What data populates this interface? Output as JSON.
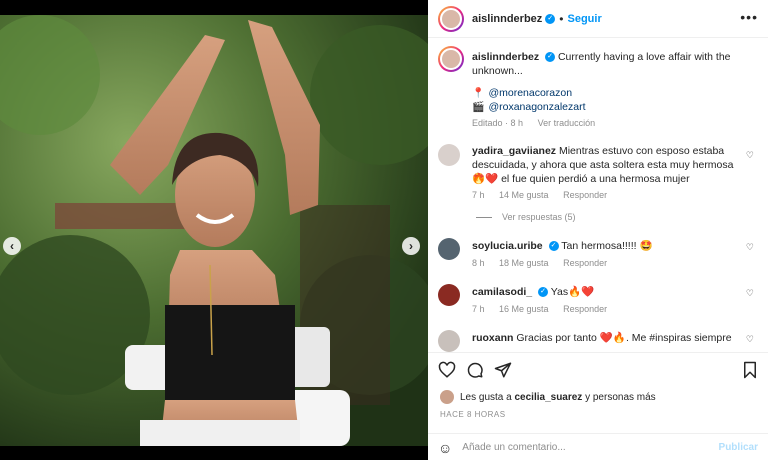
{
  "post": {
    "username": "aislinnderbez",
    "follow_label": "Seguir",
    "more_label": "•••",
    "caption_user": "aislinnderbez",
    "caption_text": "Currently having a love affair with the unknown...",
    "credit_location": "@morenacorazon",
    "credit_photo": "@roxanagonzalezart",
    "caption_edited": "Editado · 8 h",
    "caption_translation": "Ver traducción"
  },
  "comments": [
    {
      "user": "yadira_gaviianez",
      "text": "Mientras estuvo con esposo estaba descuidada, y ahora que asta soltera esta muy hermosa 🤩",
      "text2": "🔥❤️ el fue quien perdió a una hermosa mujer",
      "time": "7 h",
      "likes": "14 Me gusta",
      "reply": "Responder",
      "replies": "Ver respuestas (5)",
      "avatar_color": "#d9d0cc"
    },
    {
      "user": "soylucia.uribe",
      "text": "Tan hermosa!!!!! 🤩",
      "time": "8 h",
      "likes": "18 Me gusta",
      "reply": "Responder",
      "avatar_color": "#556470"
    },
    {
      "user": "camilasodi_",
      "text": "Yas🔥❤️",
      "time": "7 h",
      "likes": "16 Me gusta",
      "reply": "Responder",
      "avatar_color": "#8a2a22"
    },
    {
      "user": "ruoxann",
      "text": "Gracias por tanto ❤️🔥. Me #inspiras siempre",
      "avatar_color": "#c8c0bb"
    }
  ],
  "actions": {
    "likes_text_prefix": "Les gusta a ",
    "likes_user": "cecilia_suarez",
    "likes_text_suffix": " y personas más",
    "posted_time": "HACE 8 HORAS",
    "comment_placeholder": "Añade un comentario...",
    "publish_label": "Publicar"
  },
  "colors": {
    "link": "#0095f6",
    "muted": "#8e8e8e",
    "publish_disabled": "#b2dffc"
  }
}
